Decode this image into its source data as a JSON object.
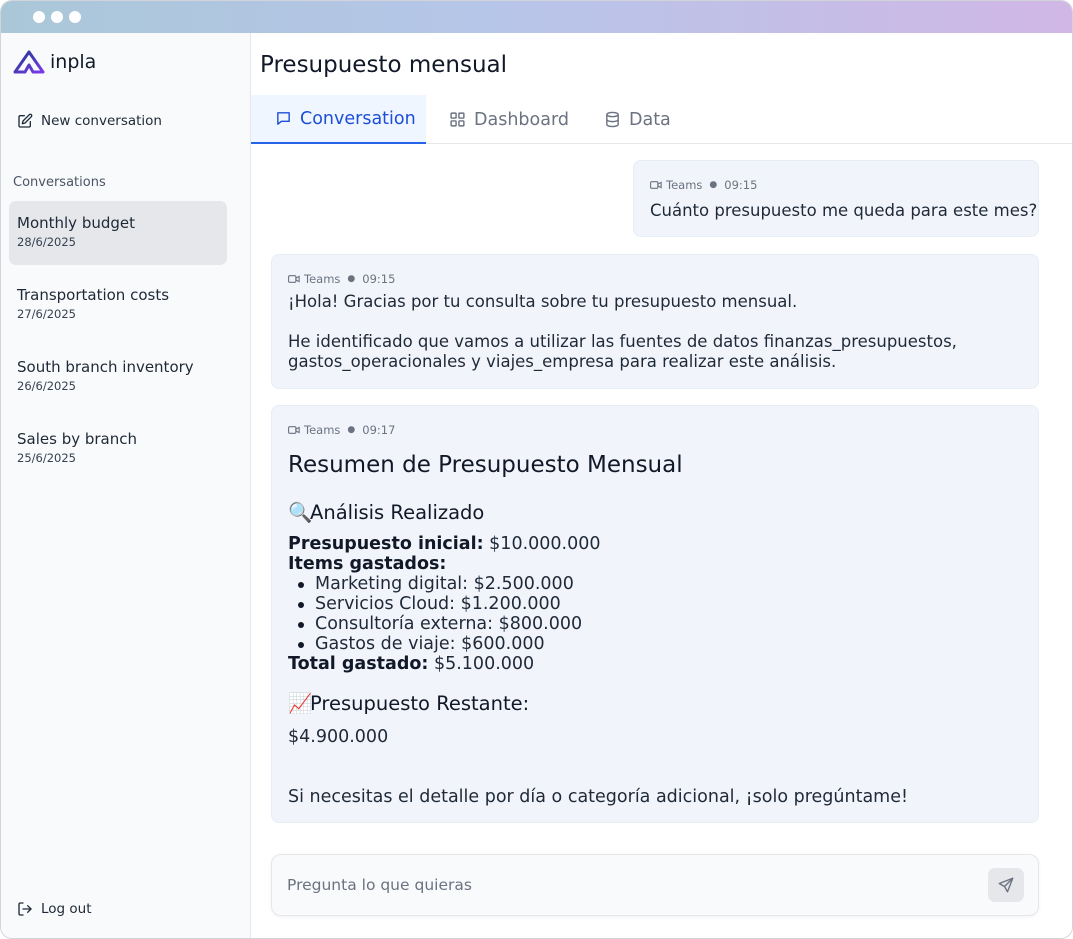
{
  "app": {
    "logo_text": "inpla"
  },
  "sidebar": {
    "new_conversation_label": "New conversation",
    "conversations_heading": "Conversations",
    "items": [
      {
        "title": "Monthly budget",
        "date": "28/6/2025",
        "active": true
      },
      {
        "title": "Transportation costs",
        "date": "27/6/2025",
        "active": false
      },
      {
        "title": "South branch inventory",
        "date": "26/6/2025",
        "active": false
      },
      {
        "title": "Sales by branch",
        "date": "25/6/2025",
        "active": false
      }
    ],
    "logout_label": "Log out"
  },
  "main": {
    "title": "Presupuesto mensual",
    "tabs": [
      {
        "label": "Conversation",
        "icon": "chat-icon",
        "active": true
      },
      {
        "label": "Dashboard",
        "icon": "grid-icon",
        "active": false
      },
      {
        "label": "Data",
        "icon": "database-icon",
        "active": false
      }
    ]
  },
  "messages": [
    {
      "source": "Teams",
      "time": "09:15",
      "text": "Cuánto presupuesto me queda para este mes?"
    },
    {
      "source": "Teams",
      "time": "09:15",
      "p1": "¡Hola! Gracias por tu consulta sobre tu presupuesto mensual.",
      "p2": "He identificado que vamos a utilizar las fuentes de datos finanzas_presupuestos, gastos_operacionales y viajes_empresa para realizar este análisis."
    },
    {
      "source": "Teams",
      "time": "09:17",
      "heading": "Resumen de Presupuesto Mensual",
      "analysis_emoji": "🔍",
      "analysis_heading": "Análisis Realizado",
      "initial_label": "Presupuesto inicial:",
      "initial_value": "$10.000.000",
      "items_label": "Items gastados:",
      "items": [
        "Marketing digital: $2.500.000",
        "Servicios Cloud: $1.200.000",
        "Consultoría externa: $800.000",
        "Gastos de viaje: $600.000"
      ],
      "total_label": "Total gastado:",
      "total_value": "$5.100.000",
      "remaining_emoji": "📈",
      "remaining_heading": "Presupuesto Restante:",
      "remaining_value": "$4.900.000",
      "closing": "Si necesitas el detalle por día o categoría adicional, ¡solo pregúntame!"
    }
  ],
  "input": {
    "placeholder": "Pregunta lo que quieras",
    "value": ""
  },
  "colors": {
    "accent": "#2563eb",
    "active_tab_bg": "#eff6ff",
    "bubble_bg": "#f1f5fb"
  }
}
